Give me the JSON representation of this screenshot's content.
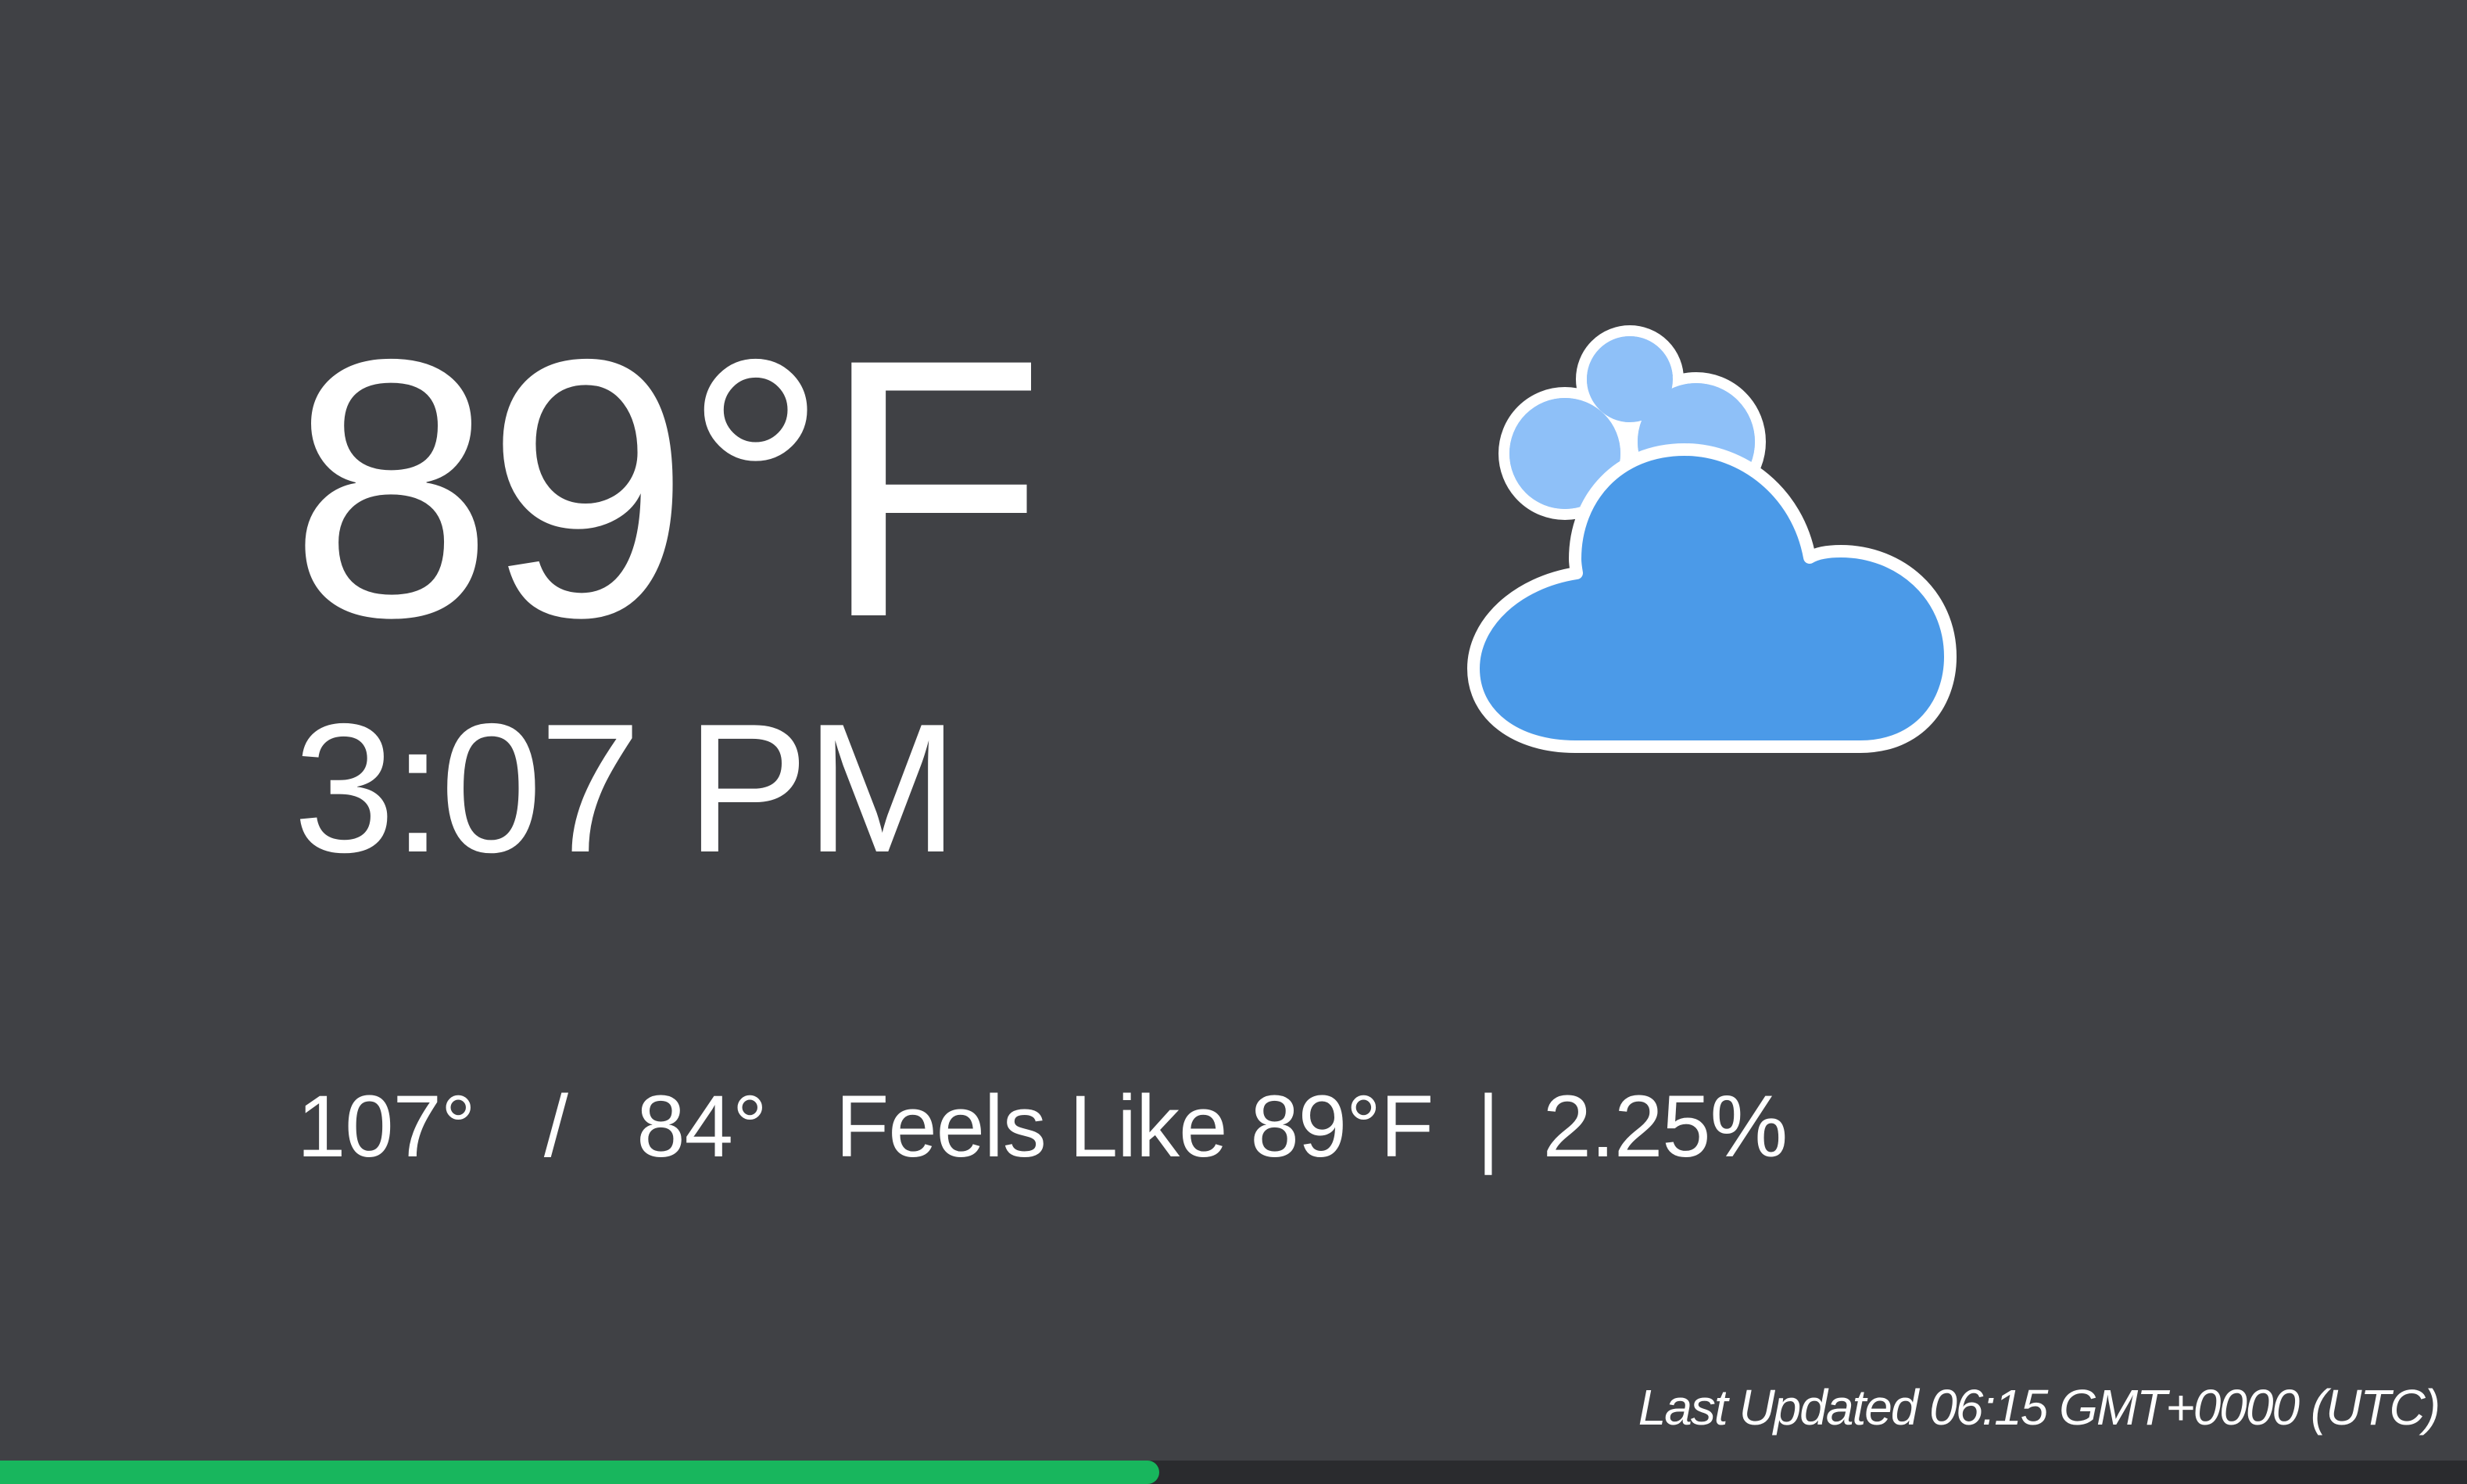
{
  "weather": {
    "temperature": "89°F",
    "time": "3:07 PM",
    "high": "107°",
    "separator": "/",
    "low": "84°",
    "feels_like": "Feels Like 89°F",
    "pipe": "|",
    "precip": "2.25%",
    "last_updated": "Last Updated 06:15 GMT+0000 (UTC)",
    "icon": "cloudy-icon"
  },
  "progress": {
    "value": 0.47,
    "color": "#18b65d"
  },
  "colors": {
    "background": "#404145",
    "text": "#ffffff",
    "cloud_back": "#8ec0f8",
    "cloud_front": "#4b9ae8",
    "cloud_outline": "#ffffff",
    "progress_track": "#2a2b2e"
  }
}
